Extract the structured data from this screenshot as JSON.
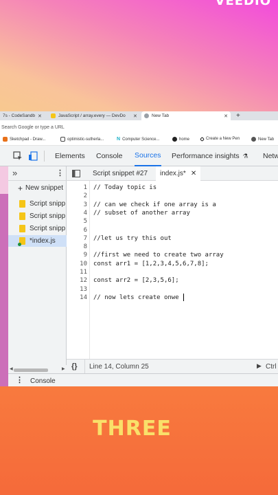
{
  "watermark_top": "VEEDIO",
  "browser": {
    "tabs": [
      {
        "label": "7s - CodeSandb",
        "active": false
      },
      {
        "label": "JavaScript / array.every — DevDo",
        "active": false
      },
      {
        "label": "New Tab",
        "active": true
      }
    ],
    "new_tab_symbol": "+",
    "address_placeholder": "Search Google or type a URL",
    "bookmarks": [
      {
        "label": "Sketchpad - Draw...",
        "icon": "sketchpad-icon"
      },
      {
        "label": "optimistic-sutherla...",
        "icon": "page-icon"
      },
      {
        "label": "Computer Science...",
        "icon": "n-logo-icon"
      },
      {
        "label": "home",
        "icon": "github-icon"
      },
      {
        "label": "Create a New Pen",
        "icon": "codepen-icon"
      },
      {
        "label": "New Tab",
        "icon": "tab-icon"
      }
    ]
  },
  "devtools": {
    "tabs": [
      {
        "label": "Elements"
      },
      {
        "label": "Console"
      },
      {
        "label": "Sources",
        "active": true
      },
      {
        "label": "Performance insights"
      },
      {
        "label": "Netw"
      }
    ],
    "navigator": {
      "chevron": "»",
      "new_snippet": "New snippet",
      "snippets": [
        {
          "label": "Script snipp"
        },
        {
          "label": "Script snipp"
        },
        {
          "label": "Script snipp"
        },
        {
          "label": "*index.js",
          "selected": true
        }
      ]
    },
    "editor_tabs": [
      {
        "label": "Script snippet #27"
      },
      {
        "label": "index.js*",
        "active": true
      }
    ],
    "code_lines": [
      {
        "n": "1",
        "text": "// Today topic is"
      },
      {
        "n": "2",
        "text": ""
      },
      {
        "n": "3",
        "text": "// can we check if one array is a"
      },
      {
        "n": "4",
        "text": "// subset of another array"
      },
      {
        "n": "5",
        "text": ""
      },
      {
        "n": "6",
        "text": ""
      },
      {
        "n": "7",
        "text": "//let us try this out"
      },
      {
        "n": "8",
        "text": ""
      },
      {
        "n": "9",
        "text": "//first we need to create two array"
      },
      {
        "n": "10",
        "text": "const arr1 = [1,2,3,4,5,6,7,8];"
      },
      {
        "n": "11",
        "text": ""
      },
      {
        "n": "12",
        "text": "const arr2 = [2,3,5,6];"
      },
      {
        "n": "13",
        "text": ""
      },
      {
        "n": "14",
        "text": "// now lets create onwe "
      }
    ],
    "status": {
      "braces": "{}",
      "position": "Line 14, Column 25",
      "right": "Ctrl"
    },
    "drawer_label": "Console"
  },
  "bottom_word": "THREE",
  "colors": {
    "accent": "#1a73e8",
    "bottom_band": "#f56a3a",
    "bottom_text": "#f9e06a"
  }
}
